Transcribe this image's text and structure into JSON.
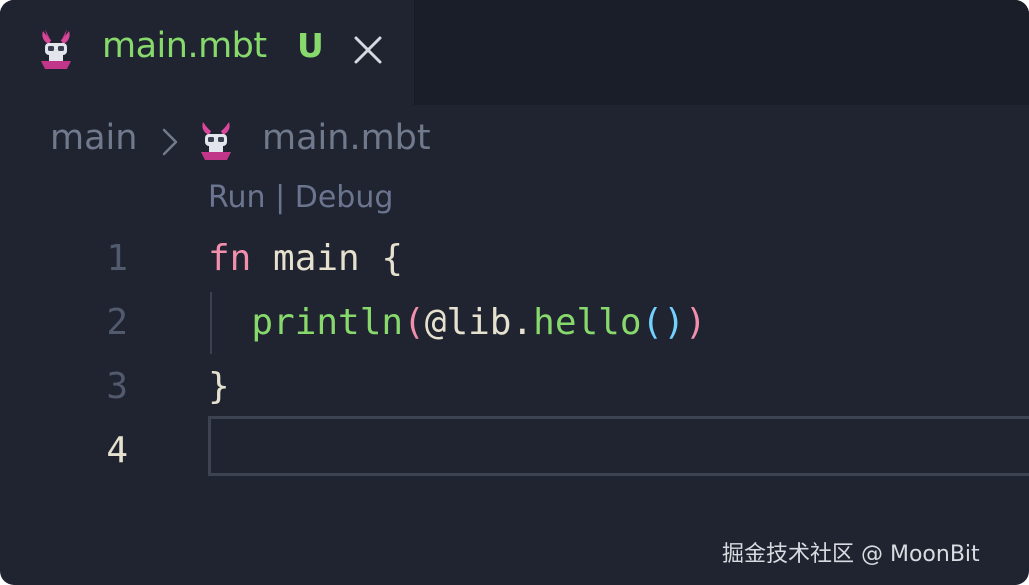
{
  "tab": {
    "filename": "main.mbt",
    "status": "U"
  },
  "breadcrumb": {
    "folder": "main",
    "file": "main.mbt"
  },
  "codelens": {
    "run": "Run",
    "separator": " | ",
    "debug": "Debug"
  },
  "gutter": [
    "1",
    "2",
    "3",
    "4"
  ],
  "code": {
    "line1": {
      "keyword": "fn",
      "rest": " main {"
    },
    "line2": {
      "indent": "  ",
      "call": "println",
      "open1": "(",
      "module": "@lib.",
      "method": "hello",
      "open2": "(",
      "close2": ")",
      "close1": ")"
    },
    "line3": "}",
    "line4": ""
  },
  "watermark": "掘金技术社区 @ MoonBit",
  "colors": {
    "editor_bg": "#1f2430",
    "keyword": "#f28fad",
    "function": "#87d96c",
    "modified_tab": "#87d96c",
    "bracket_inner": "#73d0ff"
  },
  "icons": {
    "file": "moonbit-rabbit-icon",
    "close": "close-icon",
    "chevron": "chevron-right-icon"
  }
}
